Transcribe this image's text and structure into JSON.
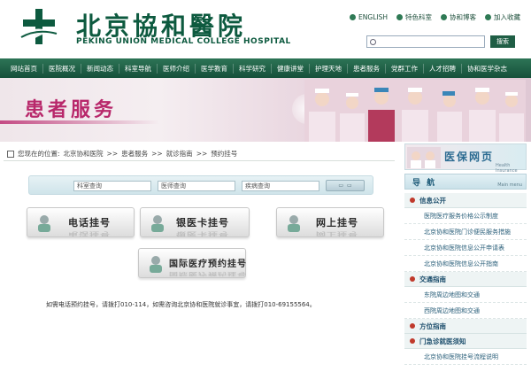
{
  "header": {
    "logo_cn": "北京協和醫院",
    "logo_en": "PEKING UNION MEDICAL COLLEGE HOSPITAL",
    "top_links": [
      "ENGLISH",
      "特色科室",
      "协和博客",
      "加入收藏"
    ],
    "search_placeholder": "",
    "search_button": "搜索"
  },
  "nav": {
    "items": [
      "网站首页",
      "医院概况",
      "新闻动态",
      "科室导航",
      "医师介绍",
      "医学教育",
      "科学研究",
      "健康讲堂",
      "护理天地",
      "患者服务",
      "党群工作",
      "人才招聘",
      "协和医学杂志"
    ]
  },
  "banner": {
    "title": "患者服务"
  },
  "breadcrumb": {
    "prefix": "您现在的位置:",
    "items": [
      "北京协和医院",
      ">>",
      "患者服务",
      ">>",
      "就诊指南",
      ">>",
      "预约挂号"
    ]
  },
  "query": {
    "inputs": [
      "科室查询",
      "医师查询",
      "疾病查询"
    ]
  },
  "appointments": [
    {
      "label": "电话挂号"
    },
    {
      "label": "银医卡挂号"
    },
    {
      "label": "网上挂号"
    },
    {
      "label": "国际医疗预约挂号"
    }
  ],
  "info": "如需电话预约挂号，请拨打010-114，如需咨询北京协和医院就诊事宜，请拨打010-69155564。",
  "sidebar": {
    "banner_title": "医保网页",
    "banner_sub": "Health Insurance",
    "nav_label": "导 航",
    "nav_sub": "Main menu",
    "sections": [
      {
        "title": "信息公开",
        "links": [
          "医院医疗服务价格公示制度",
          "北京协和医院门诊便民服务措施",
          "北京协和医院信息公开申请表",
          "北京协和医院信息公开指南"
        ]
      },
      {
        "title": "交通指南",
        "links": [
          "东院周边地图和交通",
          "西院周边地图和交通"
        ]
      },
      {
        "title": "方位指南",
        "links": []
      },
      {
        "title": "门急诊就医须知",
        "links": [
          "北京协和医院挂号流程说明"
        ]
      }
    ]
  },
  "colors": {
    "brand_green": "#0d5a3f",
    "banner_pink": "#b8286b",
    "link_blue": "#2a5f7a"
  }
}
